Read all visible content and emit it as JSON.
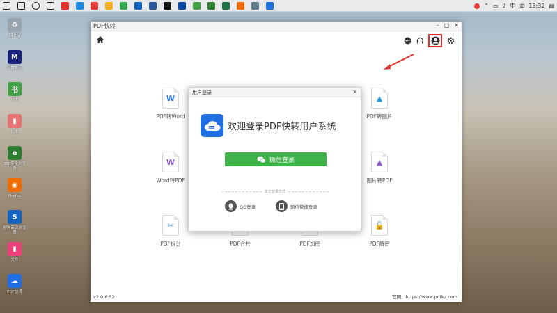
{
  "taskbar": {
    "clock": "13:32",
    "ime": "中",
    "icons": [
      {
        "name": "start-icon",
        "color": "#222222"
      },
      {
        "name": "search-icon",
        "color": "#222222"
      },
      {
        "name": "cortana-icon",
        "color": "#222222"
      },
      {
        "name": "task-view-icon",
        "color": "#222222"
      },
      {
        "name": "app-red-icon",
        "color": "#e0302b"
      },
      {
        "name": "app-browser-icon",
        "color": "#1e88e5"
      },
      {
        "name": "app-red2-icon",
        "color": "#e53935"
      },
      {
        "name": "app-files-icon",
        "color": "#f2b01e"
      },
      {
        "name": "app-chrome-icon",
        "color": "#34a853"
      },
      {
        "name": "app-blue-icon",
        "color": "#1565c0"
      },
      {
        "name": "app-word-icon",
        "color": "#2b579a"
      },
      {
        "name": "app-qq-icon",
        "color": "#111111"
      },
      {
        "name": "app-term-icon",
        "color": "#0d47a1"
      },
      {
        "name": "app-green-icon",
        "color": "#43a047"
      },
      {
        "name": "app-wechat-icon",
        "color": "#2e7d32"
      },
      {
        "name": "app-excel-icon",
        "color": "#217346"
      },
      {
        "name": "app-orange-icon",
        "color": "#ef6c00"
      },
      {
        "name": "app-gray-icon",
        "color": "#607d8b"
      },
      {
        "name": "app-pdf-icon",
        "color": "#1f6fe0"
      }
    ]
  },
  "desktop": {
    "icons": [
      {
        "label": "回收站",
        "color": "#9aa4ad",
        "glyph": "♻"
      },
      {
        "label": "迅雷影音",
        "color": "#1a237e",
        "glyph": "M"
      },
      {
        "label": "小书",
        "color": "#43a047",
        "glyph": "书"
      },
      {
        "label": "记本",
        "color": "#e57373",
        "glyph": "▮"
      },
      {
        "label": "360安全浏览器",
        "color": "#2e7d32",
        "glyph": "e"
      },
      {
        "label": "Firefox",
        "color": "#ef6c00",
        "glyph": "◉"
      },
      {
        "label": "搜狗高速浏览器",
        "color": "#1565c0",
        "glyph": "S"
      },
      {
        "label": "文件",
        "color": "#ec407a",
        "glyph": "▮"
      },
      {
        "label": "PDF快转",
        "color": "#1f6fe0",
        "glyph": "☁"
      }
    ]
  },
  "window": {
    "title": "PDF快转",
    "controls": {
      "minimize": "–",
      "maximize": "▢",
      "close": "✕"
    },
    "version": "v2.0.6.52",
    "website": "官网：https://www.pdfkz.com"
  },
  "tools": [
    {
      "label": "PDF转Word",
      "glyph": "W",
      "color": "#2b7be0"
    },
    {
      "label": "PDF转图片",
      "glyph": "▲",
      "color": "#2b9be0"
    },
    {
      "label": "Word转PDF",
      "glyph": "W",
      "color": "#8e5bd1"
    },
    {
      "label": "图片转PDF",
      "glyph": "▲",
      "color": "#8e5bd1"
    },
    {
      "label": "PDF拆分",
      "glyph": "✂",
      "color": "#3a8fd6"
    },
    {
      "label": "PDF合并",
      "glyph": "⊕",
      "color": "#3a8fd6"
    },
    {
      "label": "PDF加密",
      "glyph": "🔒",
      "color": "#3a8fd6"
    },
    {
      "label": "PDF解密",
      "glyph": "🔓",
      "color": "#3a8fd6"
    }
  ],
  "dialog": {
    "title": "用户登录",
    "close": "✕",
    "welcome": "欢迎登录PDF快转用户系统",
    "wechat_login": "微信登录",
    "other_methods": "其它登录方式",
    "qq_login": "QQ登录",
    "sms_login": "短信快捷登录"
  },
  "colors": {
    "highlight": "#e0302b",
    "wechat_green": "#3fb34a",
    "brand_blue": "#1f6fe0"
  }
}
